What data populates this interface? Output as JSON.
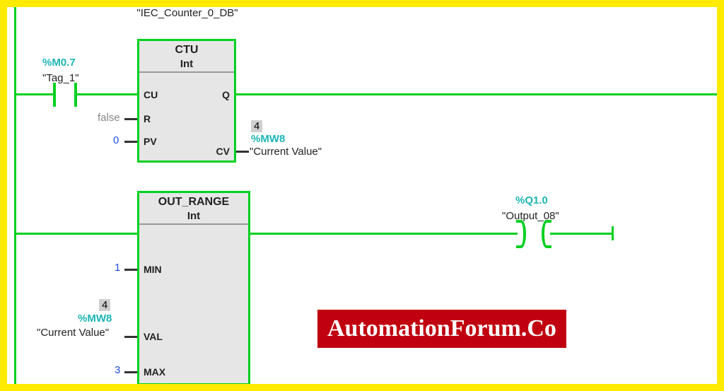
{
  "colors": {
    "frame": "#ffeb00",
    "wire": "#00d020",
    "teal": "#1bb5b5",
    "blue": "#2050e0",
    "watermark_bg": "#c00010"
  },
  "rung1": {
    "instance_name": "\"IEC_Counter_0_DB\"",
    "left_contact": {
      "address": "%M0.7",
      "symbol": "\"Tag_1\""
    },
    "block": {
      "title": "CTU",
      "type": "Int",
      "pins_left": {
        "CU": "CU",
        "R": "R",
        "PV": "PV"
      },
      "pins_right": {
        "Q": "Q",
        "CV": "CV"
      },
      "inputs": {
        "R_value": "false",
        "PV_value": "0"
      },
      "outputs": {
        "CV_val_overlay": "4",
        "CV_address": "%MW8",
        "CV_symbol": "\"Current Value\""
      }
    }
  },
  "rung2": {
    "block": {
      "title": "OUT_RANGE",
      "type": "Int",
      "pins_left": {
        "MIN": "MIN",
        "VAL": "VAL",
        "MAX": "MAX"
      },
      "inputs": {
        "MIN_value": "1",
        "VAL_overlay": "4",
        "VAL_address": "%MW8",
        "VAL_symbol": "\"Current Value\"",
        "MAX_value": "3"
      }
    },
    "right_coil": {
      "address": "%Q1.0",
      "symbol": "\"Output_08\""
    }
  },
  "watermark": "AutomationForum.Co",
  "icon_names": {
    "contact": "normally-open-contact-icon",
    "coil": "output-coil-icon"
  }
}
